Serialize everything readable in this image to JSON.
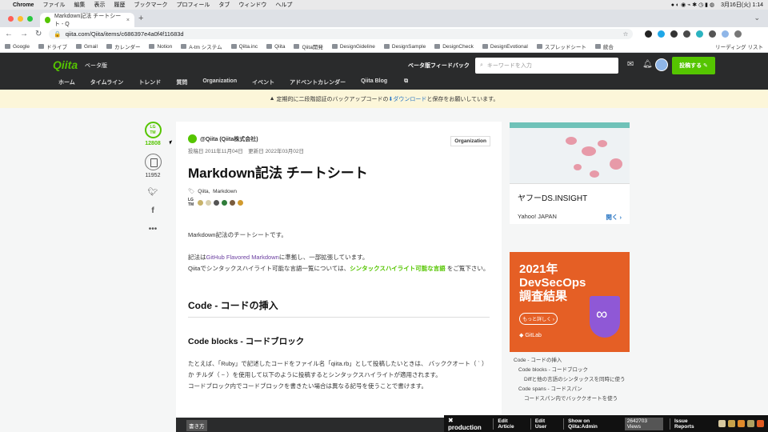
{
  "mac_menubar": {
    "app": "Chrome",
    "menus": [
      "ファイル",
      "編集",
      "表示",
      "履歴",
      "ブックマーク",
      "プロフィール",
      "タブ",
      "ウィンドウ",
      "ヘルプ"
    ],
    "clock": "3月16日(火)  1:14"
  },
  "browser": {
    "tab_title": "Markdown記法 チートシート - Q",
    "url": "qiita.com/Qiita/items/c686397e4a0f4f11683d",
    "bookmarks": [
      "Google",
      "ドライブ",
      "Gmail",
      "カレンダー",
      "Notion",
      "A-tm システム",
      "Qiita.inc",
      "Qiita",
      "Qiita開発",
      "DesignGideline",
      "DesignSample",
      "DesignCheck",
      "DesignEvotional",
      "スプレッドシート",
      "統合"
    ],
    "reading_list": "リーディング リスト"
  },
  "qiita_header": {
    "logo": "Qiita",
    "beta": "ベータ版",
    "feedback": "ベータ版フィードバック",
    "search_placeholder": "キーワードを入力",
    "post_button": "投稿する",
    "nav": [
      "ホーム",
      "タイムライン",
      "トレンド",
      "質問",
      "Organization",
      "イベント",
      "アドベントカレンダー",
      "Qiita Blog"
    ]
  },
  "notice": {
    "before": "定期的に二段階認証のバックアップコードの",
    "link": "ダウンロード",
    "after": "と保存をお願いしています。"
  },
  "rail": {
    "lgtm_label_top": "LG",
    "lgtm_label_bottom": "TM",
    "lgtm_count": "12808",
    "stock_count": "11952"
  },
  "article": {
    "author": "@Qiita (Qiita株式会社)",
    "org_badge": "Organization",
    "dates": "投稿日 2011年11月04日　更新日 2022年03月02日",
    "title": "Markdown記法 チートシート",
    "tags": [
      "Qiita",
      "Markdown"
    ],
    "p1": "Markdown記法のチートシートです。",
    "p2_prefix": "記法は",
    "p2_link": "GitHub Flavored Markdown",
    "p2_suffix": "に準拠し、一部拡張しています。",
    "p3_prefix": "Qiitaでシンタックスハイライト可能な言語一覧については、",
    "p3_link": "シンタックスハイライト可能な言語",
    "p3_suffix": " をご覧下さい。",
    "h2": "Code - コードの挿入",
    "h3": "Code blocks - コードブロック",
    "p4": "たとえば、「Ruby」で記述したコードをファイル名「qiita.rb」として投稿したいときは、 バッククオート（ ` ）か チルダ（ ~ ）を使用して以下のように投稿するとシンタックスハイライトが適用されます。",
    "p5": "コードブロック内でコードブロックを書きたい場合は異なる記号を使うことで書けます。",
    "write_label": "書き方"
  },
  "ads": {
    "ad1_title": "ヤフーDS.INSIGHT",
    "ad1_brand": "Yahoo! JAPAN",
    "ad1_open": "開く",
    "ad2_line1": "2021年",
    "ad2_line2": "DevSecOps",
    "ad2_line3": "調査結果",
    "ad2_button": "もっと詳しく",
    "ad2_brand": "GitLab"
  },
  "toc": {
    "items": [
      "Code - コードの挿入",
      "Code blocks - コードブロック",
      "Diffと他の言語のシンタックスを同時に使う",
      "Code spans - コードスパン",
      "コードスパン内でバッククオートを使う"
    ]
  },
  "admin_bar": {
    "env": "production",
    "links": [
      "Edit Article",
      "Edit User",
      "Show on Qiita:Admin"
    ],
    "views": "2642703 Views",
    "issue": "Issue Reports"
  },
  "colors": {
    "qiita_green": "#55c500",
    "header_dark": "#2a2b2c",
    "gitlab_orange": "#e55f25"
  }
}
